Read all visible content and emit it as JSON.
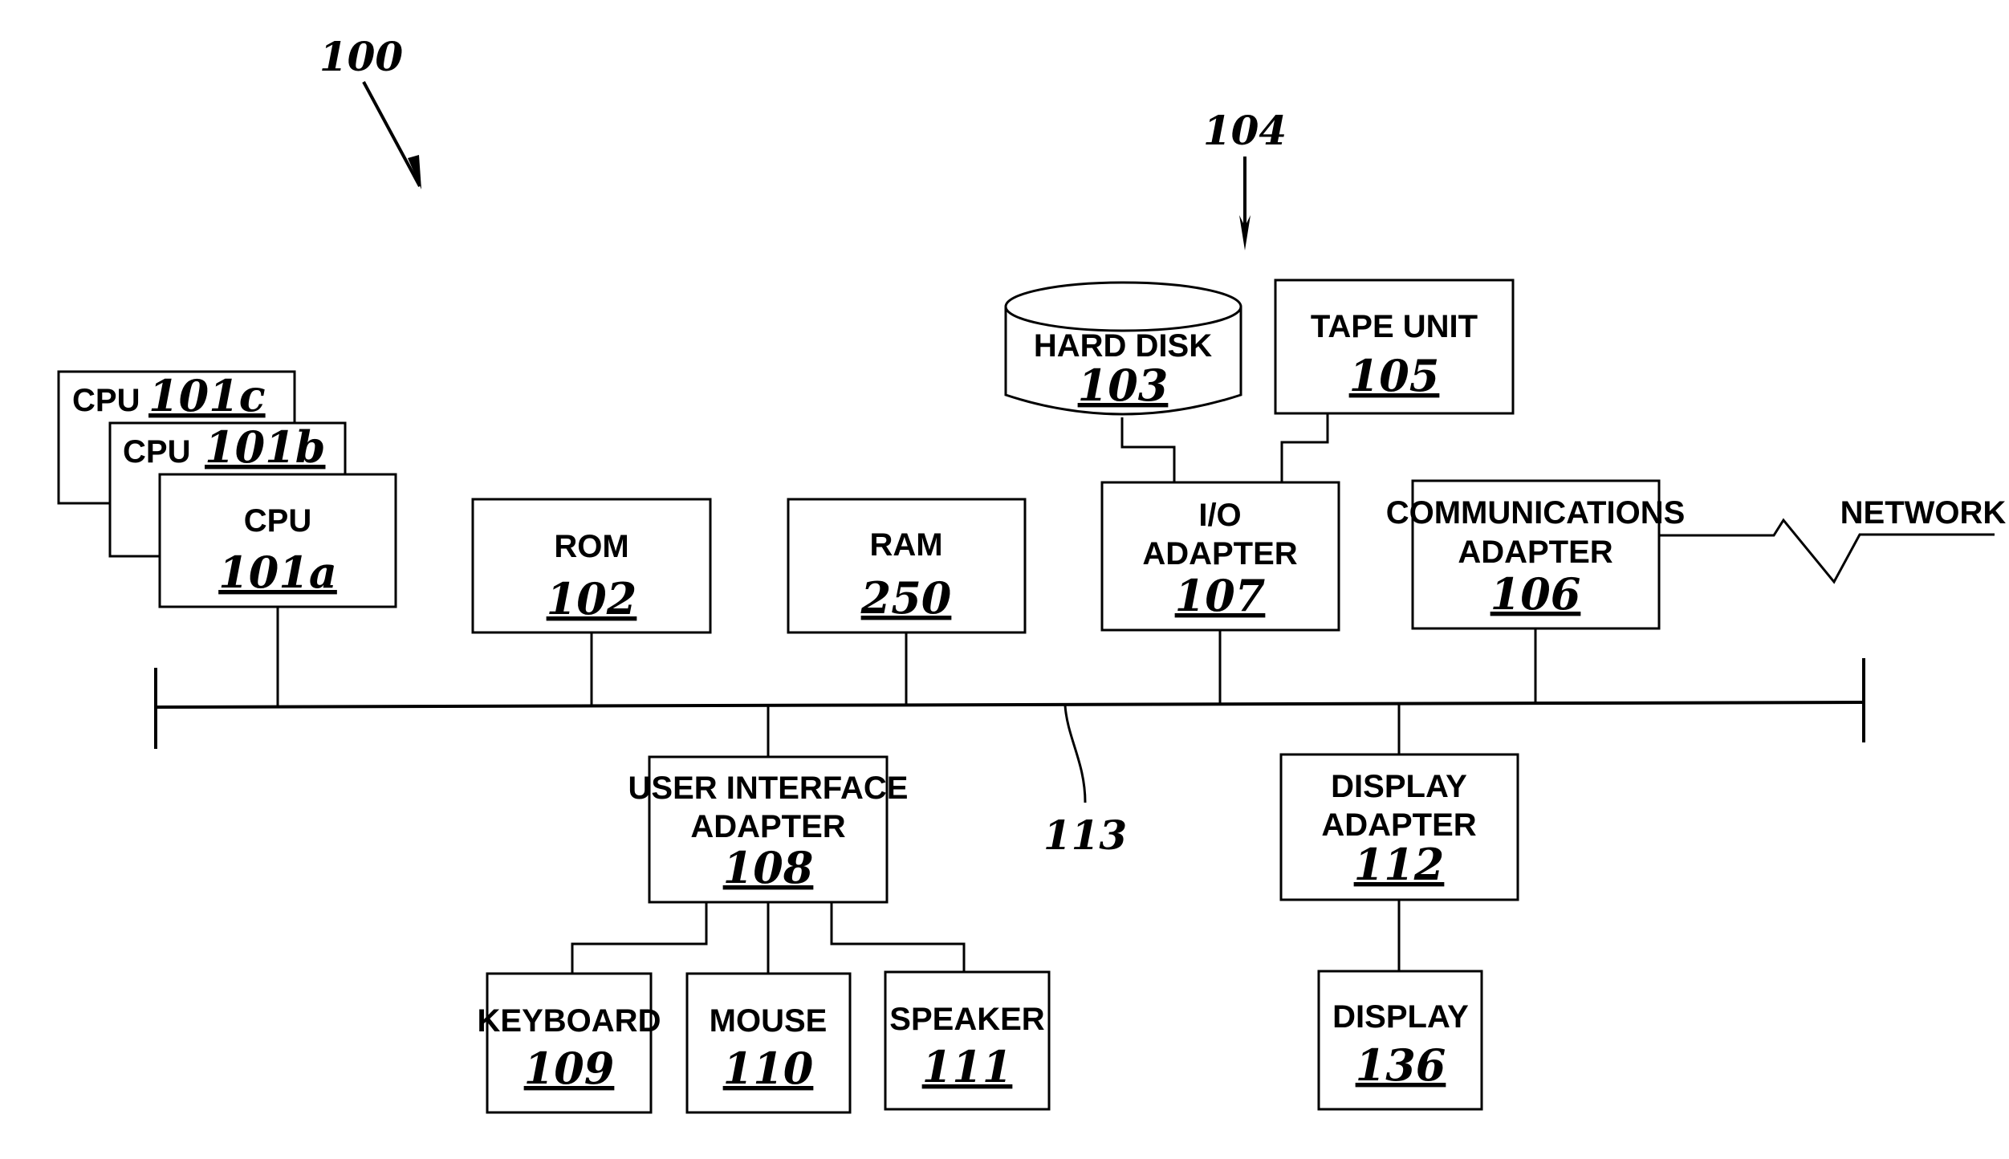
{
  "figure": {
    "system_ref": "100",
    "storage_group_ref": "104",
    "bus_ref": "113",
    "network_label": "NETWORK"
  },
  "components": {
    "cpu_c": {
      "label": "CPU",
      "ref": "101c"
    },
    "cpu_b": {
      "label": "CPU",
      "ref": "101b"
    },
    "cpu_a": {
      "label": "CPU",
      "ref": "101a"
    },
    "rom": {
      "label": "ROM",
      "ref": "102"
    },
    "ram": {
      "label": "RAM",
      "ref": "250"
    },
    "hard_disk": {
      "label": "HARD DISK",
      "ref": "103"
    },
    "tape_unit": {
      "label": "TAPE UNIT",
      "ref": "105"
    },
    "io_adapter": {
      "label_line1": "I/O",
      "label_line2": "ADAPTER",
      "ref": "107"
    },
    "comms_adapter": {
      "label_line1": "COMMUNICATIONS",
      "label_line2": "ADAPTER",
      "ref": "106"
    },
    "ui_adapter": {
      "label_line1": "USER INTERFACE",
      "label_line2": "ADAPTER",
      "ref": "108"
    },
    "display_adapter": {
      "label_line1": "DISPLAY",
      "label_line2": "ADAPTER",
      "ref": "112"
    },
    "keyboard": {
      "label": "KEYBOARD",
      "ref": "109"
    },
    "mouse": {
      "label": "MOUSE",
      "ref": "110"
    },
    "speaker": {
      "label": "SPEAKER",
      "ref": "111"
    },
    "display": {
      "label": "DISPLAY",
      "ref": "136"
    }
  }
}
